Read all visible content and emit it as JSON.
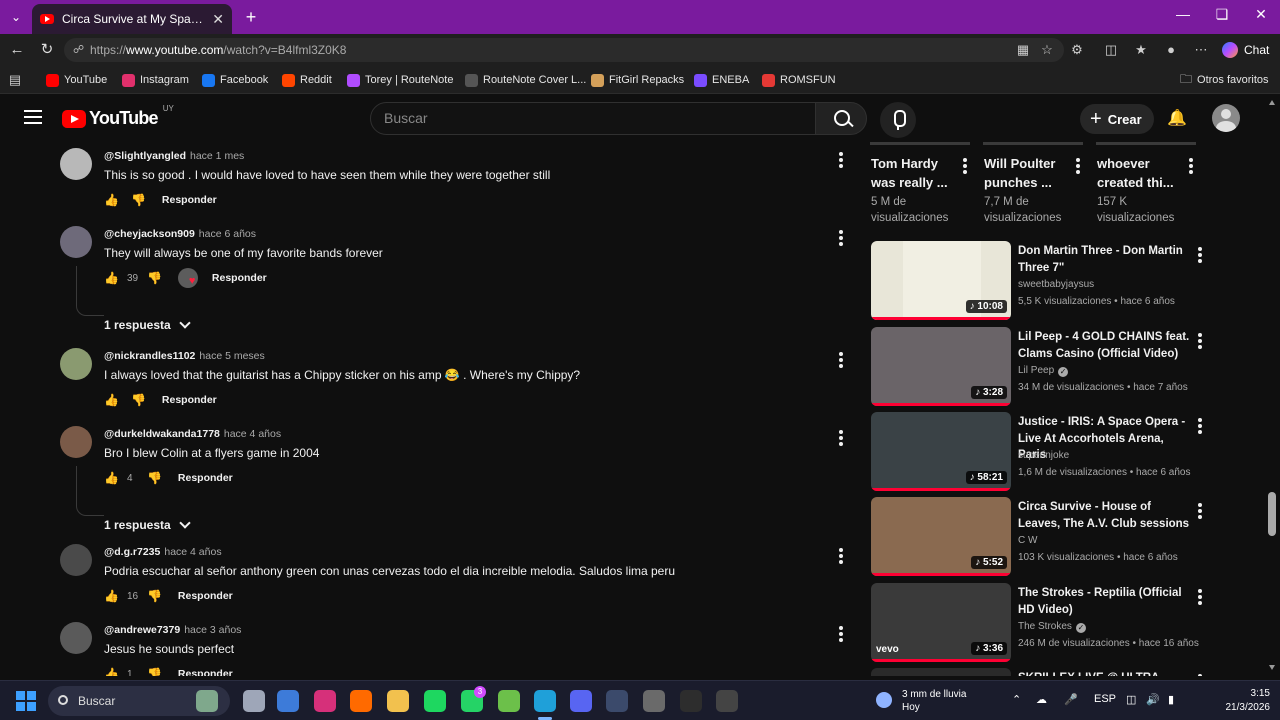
{
  "browser": {
    "tab_title": "Circa Survive at My Space Transmis...",
    "new_tab": "+",
    "url_prefix": "https://",
    "url_host": "www.youtube.com",
    "url_path": "/watch?v=B4lfml3Z0K8",
    "chat_label": "Chat",
    "bookmarks": [
      {
        "label": "YouTube",
        "icon": "youtube-icon",
        "color": "#ff0000"
      },
      {
        "label": "Instagram",
        "icon": "instagram-icon",
        "color": "#e1306c"
      },
      {
        "label": "Facebook",
        "icon": "facebook-icon",
        "color": "#1877f2"
      },
      {
        "label": "Reddit",
        "icon": "reddit-icon",
        "color": "#ff4500"
      },
      {
        "label": "Torey | RouteNote",
        "icon": "routenote-icon",
        "color": "#b04cff"
      },
      {
        "label": "RouteNote Cover L...",
        "icon": "routenote-cover-icon",
        "color": "#555555"
      },
      {
        "label": "FitGirl Repacks",
        "icon": "fitgirl-icon",
        "color": "#d4a05a"
      },
      {
        "label": "ENEBA",
        "icon": "eneba-icon",
        "color": "#7a4cff"
      },
      {
        "label": "ROMSFUN",
        "icon": "romsfun-icon",
        "color": "#e53935"
      }
    ],
    "other_favorites": "Otros favoritos"
  },
  "youtube": {
    "logo_text": "YouTube",
    "country_code": "UY",
    "search_placeholder": "Buscar",
    "create_label": "Crear"
  },
  "comments": [
    {
      "author": "@Slightlyangled",
      "time": "hace 1 mes",
      "text": "This is so good . I would have loved to have seen them while they were together still",
      "likes": "",
      "reply": "Responder",
      "avatar_color": "#b8b8b8"
    },
    {
      "author": "@cheyjackson909",
      "time": "hace 6 años",
      "text": "They will always be one of my favorite bands forever",
      "likes": "39",
      "reply": "Responder",
      "replies": "1 respuesta",
      "avatar_color": "#6e6a7a"
    },
    {
      "author": "@nickrandles1102",
      "time": "hace 5 meses",
      "text": "I always loved that the guitarist has a Chippy sticker on his amp 😂 .    Where's my Chippy?",
      "likes": "",
      "reply": "Responder",
      "avatar_color": "#8a9a70"
    },
    {
      "author": "@durkeldwakanda1778",
      "time": "hace 4 años",
      "text": "Bro I blew Colin at a flyers game in 2004",
      "likes": "4",
      "reply": "Responder",
      "replies": "1 respuesta",
      "avatar_color": "#7a5a48"
    },
    {
      "author": "@d.g.r7235",
      "time": "hace 4 años",
      "text": "Podria escuchar al señor anthony green con unas cervezas todo el dia increible melodia. Saludos lima peru",
      "likes": "16",
      "reply": "Responder",
      "avatar_color": "#4a4a4a"
    },
    {
      "author": "@andrewe7379",
      "time": "hace 3 años",
      "text": "Jesus he sounds perfect",
      "likes": "1",
      "reply": "Responder",
      "avatar_color": "#5a5a5a"
    }
  ],
  "shorts": [
    {
      "title": "Tom Hardy was really ...",
      "views": "5 M de visualizaciones"
    },
    {
      "title": "Will Poulter punches ...",
      "views": "7,7 M de visualizaciones"
    },
    {
      "title": "whoever created thi...",
      "views": "157 K visualizaciones"
    }
  ],
  "videos": [
    {
      "title": "Don Martin Three - Don Martin Three 7\"",
      "channel": "sweetbabyjaysus",
      "verified": false,
      "meta": "5,5 K visualizaciones • hace 6 años",
      "duration": "10:08",
      "thumb_color": "#e8e6d8"
    },
    {
      "title": "Lil Peep - 4 GOLD CHAINS feat. Clams Casino (Official Video)",
      "channel": "Lil Peep",
      "verified": true,
      "meta": "34 M de visualizaciones • hace 7 años",
      "duration": "3:28",
      "thumb_color": "#6a6468"
    },
    {
      "title": "Justice - IRIS: A Space Opera - Live At Accorhotels Arena, Paris",
      "channel": "superinjoke",
      "verified": false,
      "meta": "1,6 M de visualizaciones • hace 6 años",
      "duration": "58:21",
      "thumb_color": "#3a4246"
    },
    {
      "title": "Circa Survive - House of Leaves, The A.V. Club sessions",
      "channel": "C W",
      "verified": false,
      "meta": "103 K visualizaciones • hace 6 años",
      "duration": "5:52",
      "thumb_color": "#8a6a50"
    },
    {
      "title": "The Strokes - Reptilia (Official HD Video)",
      "channel": "The Strokes",
      "verified": true,
      "meta": "246 M de visualizaciones • hace 16 años",
      "duration": "3:36",
      "thumb_color": "#3a3a3a",
      "badge": "vevo"
    },
    {
      "title": "SKRILLEX LIVE @ ULTRA MUSIC",
      "channel": "",
      "verified": false,
      "meta": "",
      "duration": "",
      "thumb_color": "#2a2a2a"
    }
  ],
  "taskbar": {
    "search_label": "Buscar",
    "weather_line1": "3 mm de lluvia",
    "weather_line2": "Hoy",
    "lang": "ESP",
    "time": "3:15",
    "date": "21/3/2026",
    "whatsapp_badge": "3"
  }
}
